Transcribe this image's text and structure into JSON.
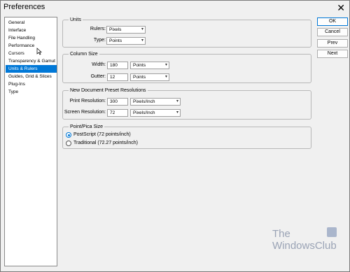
{
  "window": {
    "title": "Preferences",
    "close_glyph": "✕"
  },
  "sidebar": {
    "items": [
      {
        "label": "General"
      },
      {
        "label": "Interface"
      },
      {
        "label": "File Handling"
      },
      {
        "label": "Performance"
      },
      {
        "label": "Cursors"
      },
      {
        "label": "Transparency & Gamut"
      },
      {
        "label": "Units & Rulers"
      },
      {
        "label": "Guides, Grid & Slices"
      },
      {
        "label": "Plug-Ins"
      },
      {
        "label": "Type"
      }
    ],
    "selected": "Units & Rulers"
  },
  "units": {
    "legend": "Units",
    "rulers_label": "Rulers:",
    "rulers_value": "Pixels",
    "type_label": "Type:",
    "type_value": "Points"
  },
  "column_size": {
    "legend": "Column Size",
    "width_label": "Width:",
    "width_value": "180",
    "width_unit": "Points",
    "gutter_label": "Gutter:",
    "gutter_value": "12",
    "gutter_unit": "Points"
  },
  "preset_resolutions": {
    "legend": "New Document Preset Resolutions",
    "print_label": "Print Resolution:",
    "print_value": "300",
    "print_unit": "Pixels/Inch",
    "screen_label": "Screen Resolution:",
    "screen_value": "72",
    "screen_unit": "Pixels/Inch"
  },
  "pica": {
    "legend": "Point/Pica Size",
    "option1": "PostScript (72 points/inch)",
    "option2": "Traditional (72.27 points/inch)",
    "selected": "PostScript (72 points/inch)"
  },
  "buttons": {
    "ok": "OK",
    "cancel": "Cancel",
    "prev": "Prev",
    "next": "Next"
  },
  "watermark": {
    "line1": "The",
    "line2": "WindowsClub"
  },
  "icons": {
    "dropdown": "chevron-down-icon",
    "cursor": "mouse-pointer-icon"
  },
  "colors": {
    "selection": "#0078d7",
    "background": "#f0f0f0"
  }
}
